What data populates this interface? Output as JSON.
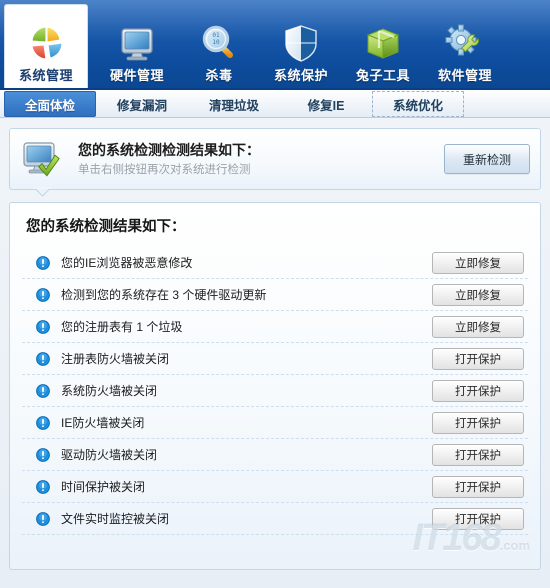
{
  "nav": {
    "items": [
      {
        "label": "系统管理",
        "icon": "pie-chart-icon",
        "active": true
      },
      {
        "label": "硬件管理",
        "icon": "monitor-icon",
        "active": false
      },
      {
        "label": "杀毒",
        "icon": "magnifier-icon",
        "active": false
      },
      {
        "label": "系统保护",
        "icon": "shield-icon",
        "active": false
      },
      {
        "label": "兔子工具",
        "icon": "green-box-icon",
        "active": false
      },
      {
        "label": "软件管理",
        "icon": "gear-wrench-icon",
        "active": false
      }
    ]
  },
  "subtabs": {
    "items": [
      {
        "label": "全面体检",
        "state": "active"
      },
      {
        "label": "修复漏洞",
        "state": "normal"
      },
      {
        "label": "清理垃圾",
        "state": "normal"
      },
      {
        "label": "修复IE",
        "state": "normal"
      },
      {
        "label": "系统优化",
        "state": "dashed"
      }
    ]
  },
  "info": {
    "icon": "monitor-check-icon",
    "title": "您的系统检测检测结果如下：",
    "subtitle": "单击右侧按钮再次对系统进行检测",
    "recheck_label": "重新检测"
  },
  "results": {
    "title": "您的系统检测结果如下：",
    "items": [
      {
        "icon": "warning-icon",
        "text": "您的IE浏览器被恶意修改",
        "action": "立即修复"
      },
      {
        "icon": "warning-icon",
        "text": "检测到您的系统存在 3 个硬件驱动更新",
        "action": "立即修复"
      },
      {
        "icon": "warning-icon",
        "text": "您的注册表有 1 个垃圾",
        "action": "立即修复"
      },
      {
        "icon": "warning-icon",
        "text": "注册表防火墙被关闭",
        "action": "打开保护"
      },
      {
        "icon": "warning-icon",
        "text": "系统防火墙被关闭",
        "action": "打开保护"
      },
      {
        "icon": "warning-icon",
        "text": "IE防火墙被关闭",
        "action": "打开保护"
      },
      {
        "icon": "warning-icon",
        "text": "驱动防火墙被关闭",
        "action": "打开保护"
      },
      {
        "icon": "warning-icon",
        "text": "时间保护被关闭",
        "action": "打开保护"
      },
      {
        "icon": "warning-icon",
        "text": "文件实时监控被关闭",
        "action": "打开保护"
      }
    ]
  },
  "watermark": {
    "text": "IT168",
    "suffix": ".com"
  },
  "colors": {
    "nav_blue": "#1a5aad",
    "tab_active": "#2f6fc0",
    "warning_blue": "#1d8fe0",
    "panel_border": "#c3d6e6",
    "separator": "#cddeee"
  }
}
